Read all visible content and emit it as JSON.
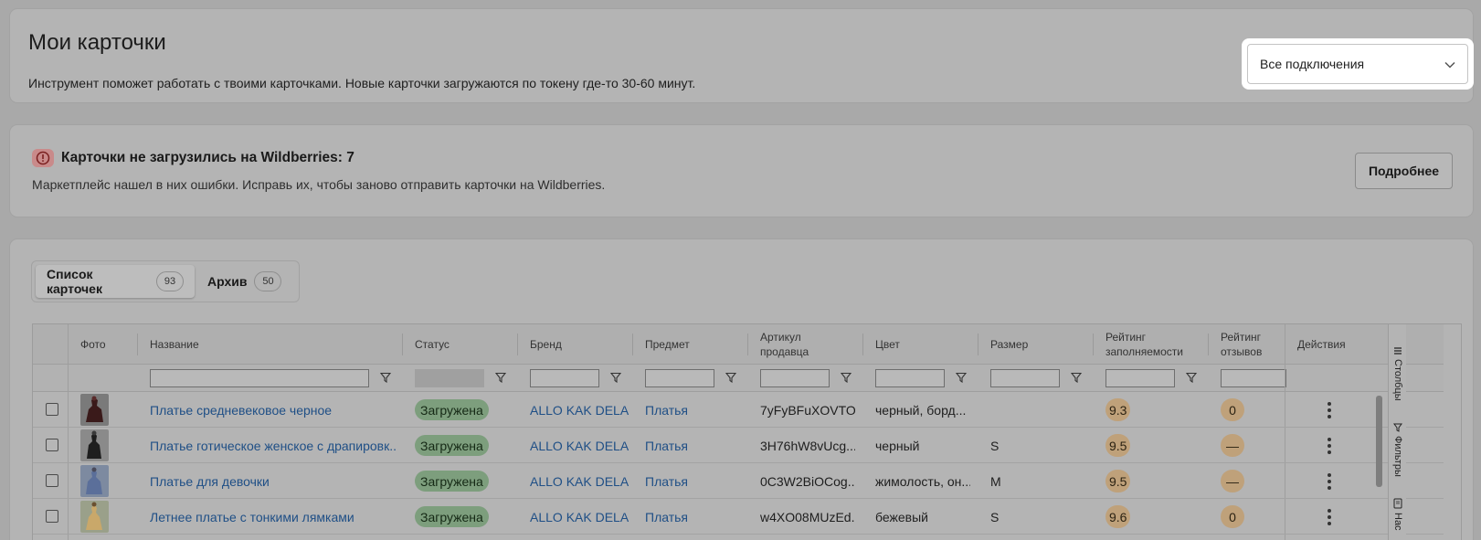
{
  "header": {
    "title": "Мои карточки",
    "subtitle": "Инструмент поможет работать с твоими карточками. Новые карточки загружаются по токену где-то 30-60 минут.",
    "connection_select": "Все подключения"
  },
  "alert": {
    "title": "Карточки не загрузились на Wildberries: 7",
    "description": "Маркетплейс нашел в них ошибки. Исправь их, чтобы заново отправить карточки на Wildberries.",
    "button": "Подробнее"
  },
  "tabs": [
    {
      "label": "Список карточек",
      "count": "93"
    },
    {
      "label": "Архив",
      "count": "50"
    }
  ],
  "columns": {
    "photo": "Фото",
    "name": "Название",
    "status": "Статус",
    "brand": "Бренд",
    "subject": "Предмет",
    "article": "Артикул продавца",
    "color": "Цвет",
    "size": "Размер",
    "fill_rating": "Рейтинг заполняемости",
    "review_rating": "Рейтинг отзывов",
    "actions": "Действия"
  },
  "side_tabs": {
    "columns": "Столбцы",
    "filters": "Фильтры",
    "settings": "Нас"
  },
  "rows": [
    {
      "name": "Платье средневековое черное",
      "status": "Загружена",
      "brand": "ALLO KAK DELA",
      "subject": "Платья",
      "article": "7yFyBFuXOVTO...",
      "color": "черный, борд...",
      "size": "",
      "fill": "9.3",
      "reviews": "0"
    },
    {
      "name": "Платье готическое женское с драпировк...",
      "status": "Загружена",
      "brand": "ALLO KAK DELA",
      "subject": "Платья",
      "article": "3H76hW8vUcg...",
      "color": "черный",
      "size": "S",
      "fill": "9.5",
      "reviews": "—"
    },
    {
      "name": "Платье для девочки",
      "status": "Загружена",
      "brand": "ALLO KAK DELA",
      "subject": "Платья",
      "article": "0C3W2BiOCog...",
      "color": "жимолость, он...",
      "size": "M",
      "fill": "9.5",
      "reviews": "—"
    },
    {
      "name": "Летнее платье с тонкими лямками",
      "status": "Загружена",
      "brand": "ALLO KAK DELA",
      "subject": "Платья",
      "article": "w4XO08MUzEd...",
      "color": "бежевый",
      "size": "S",
      "fill": "9.6",
      "reviews": "0"
    }
  ]
}
